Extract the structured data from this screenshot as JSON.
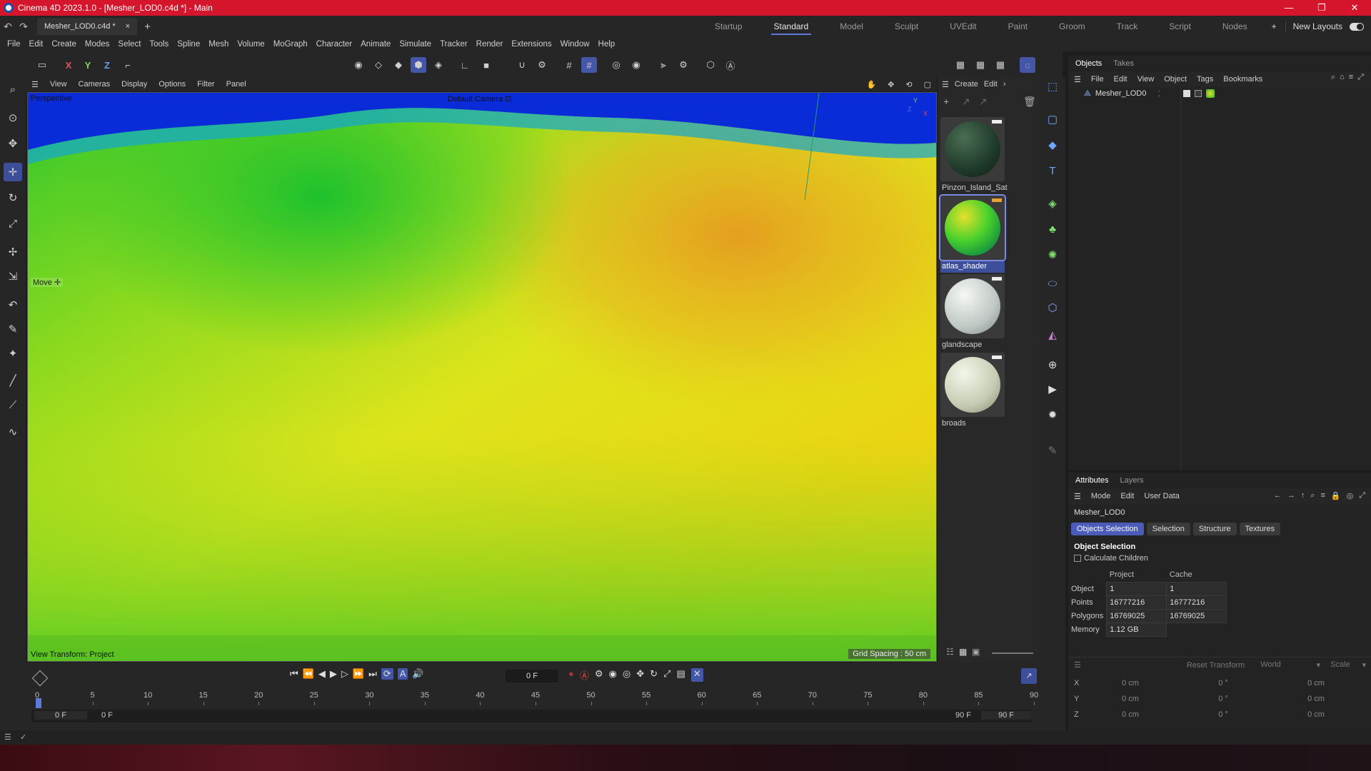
{
  "titlebar": {
    "title": "Cinema 4D 2023.1.0 - [Mesher_LOD0.c4d *] - Main",
    "minimize": "—",
    "maximize": "❐",
    "close": "✕"
  },
  "tabs": {
    "file_tab": "Mesher_LOD0.c4d *",
    "close": "×",
    "add": "+"
  },
  "layouts": [
    "Startup",
    "Standard",
    "Model",
    "Sculpt",
    "UVEdit",
    "Paint",
    "Groom",
    "Track",
    "Script",
    "Nodes"
  ],
  "layouts_active": "Standard",
  "layouts_add": "+",
  "new_layouts": "New Layouts",
  "menu": [
    "File",
    "Edit",
    "Create",
    "Modes",
    "Select",
    "Tools",
    "Spline",
    "Mesh",
    "Volume",
    "MoGraph",
    "Character",
    "Animate",
    "Simulate",
    "Tracker",
    "Render",
    "Extensions",
    "Window",
    "Help"
  ],
  "toolbar": {
    "x": "X",
    "y": "Y",
    "z": "Z"
  },
  "viewport_menu": [
    "View",
    "Cameras",
    "Display",
    "Options",
    "Filter",
    "Panel"
  ],
  "viewport": {
    "perspective": "Perspective",
    "camera": "Default Camera",
    "camera_icon": "⊡",
    "move": "Move",
    "move_icon": "✛",
    "view_transform": "View Transform: Project",
    "grid_spacing": "Grid Spacing : 50 cm",
    "axis_y": "Y",
    "axis_z": "Z",
    "axis_x": "X"
  },
  "material_menu": {
    "create": "Create",
    "edit": "Edit",
    "more": "›"
  },
  "materials": [
    {
      "name": "Pinzon_Island_Sat",
      "selected": false
    },
    {
      "name": "atlas_shader",
      "selected": true
    },
    {
      "name": "glandscape",
      "selected": false
    },
    {
      "name": "broads",
      "selected": false
    }
  ],
  "objects_panel": {
    "tabs": [
      "Objects",
      "Takes"
    ],
    "menu": [
      "File",
      "Edit",
      "View",
      "Object",
      "Tags",
      "Bookmarks"
    ],
    "items": [
      {
        "name": "Mesher_LOD0"
      }
    ]
  },
  "attributes": {
    "tabs": [
      "Attributes",
      "Layers"
    ],
    "menu": [
      "Mode",
      "Edit",
      "User Data"
    ],
    "object_name": "Mesher_LOD0",
    "subtabs": [
      "Objects Selection",
      "Selection",
      "Structure",
      "Textures"
    ],
    "section_title": "Object Selection",
    "calculate_children": "Calculate Children",
    "table": {
      "headers": [
        "Project",
        "Cache"
      ],
      "rows": [
        {
          "label": "Object",
          "project": "1",
          "cache": "1"
        },
        {
          "label": "Points",
          "project": "16777216",
          "cache": "16777216"
        },
        {
          "label": "Polygons",
          "project": "16769025",
          "cache": "16769025"
        },
        {
          "label": "Memory",
          "project": "1.12 GB",
          "cache": ""
        }
      ]
    }
  },
  "coordinates": {
    "reset": "Reset Transform",
    "space": "World",
    "scale": "Scale",
    "dropdown_arrow": "▾",
    "rows": [
      {
        "axis": "X",
        "pos": "0 cm",
        "rot": "0 °",
        "size": "0 cm"
      },
      {
        "axis": "Y",
        "pos": "0 cm",
        "rot": "0 °",
        "size": "0 cm"
      },
      {
        "axis": "Z",
        "pos": "0 cm",
        "rot": "0 °",
        "size": "0 cm"
      }
    ]
  },
  "timeline": {
    "current_frame": "0 F",
    "ruler": [
      "0",
      "5",
      "10",
      "15",
      "20",
      "25",
      "30",
      "35",
      "40",
      "45",
      "50",
      "55",
      "60",
      "65",
      "70",
      "75",
      "80",
      "85",
      "90"
    ],
    "start_field": "0 F",
    "start_field2": "0 F",
    "end_field": "90 F",
    "end_field2": "90 F"
  },
  "colors": {
    "accent": "#4a5bb8",
    "titlebar": "#d4152b"
  }
}
